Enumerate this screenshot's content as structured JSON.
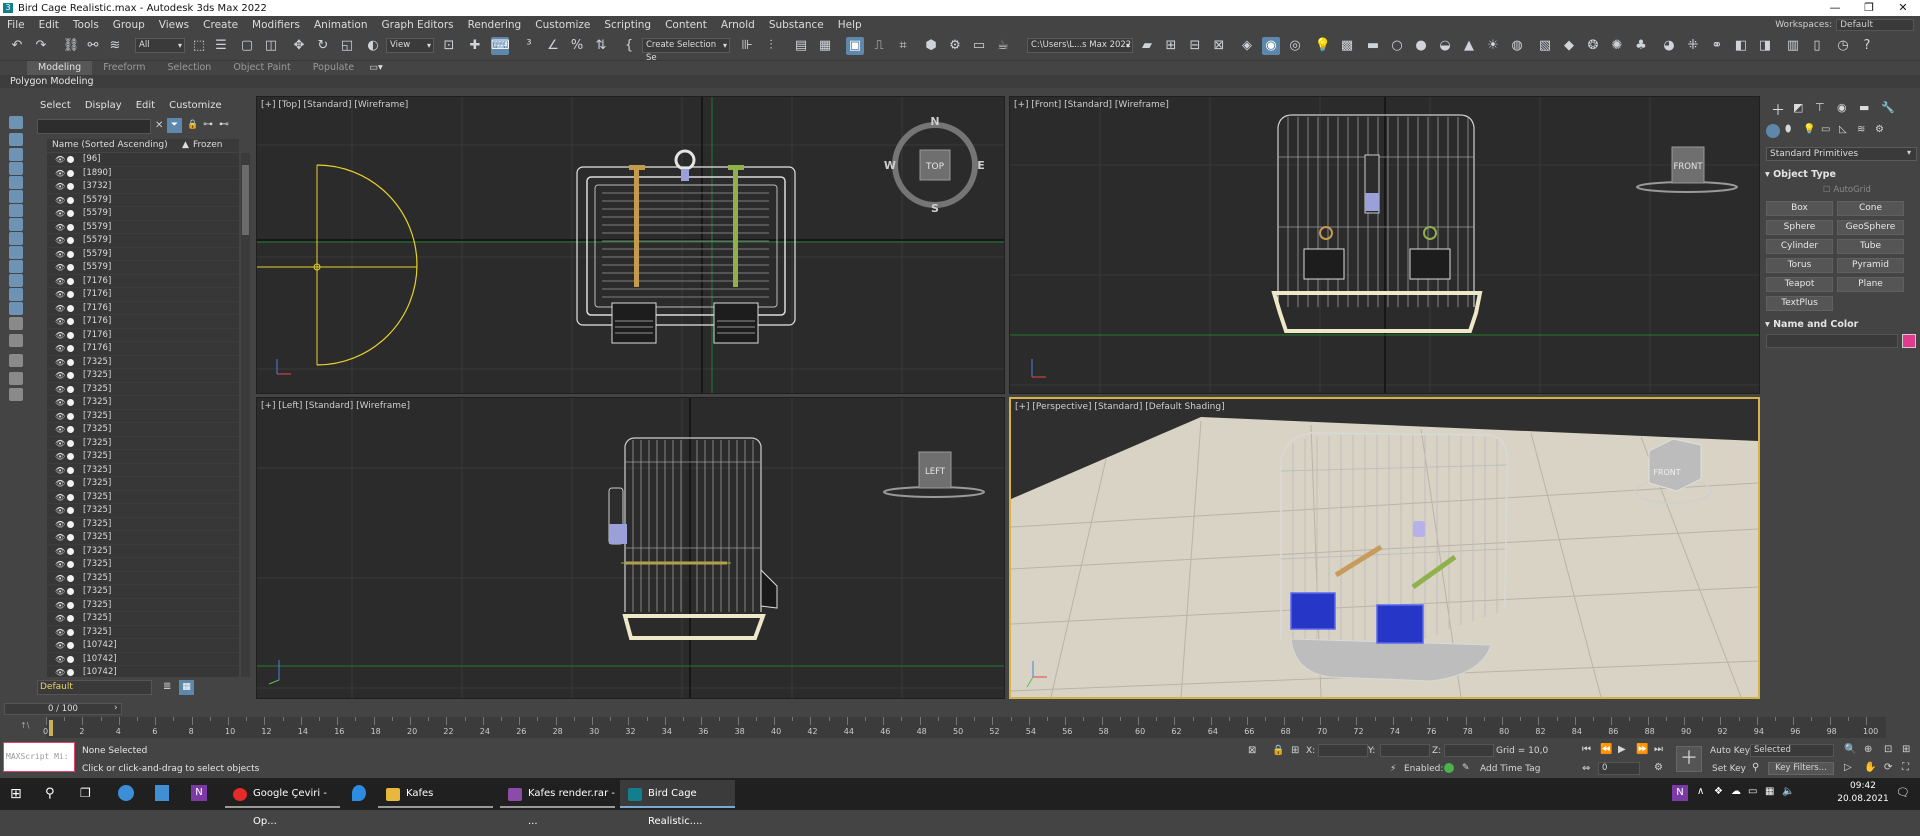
{
  "window": {
    "title": "Bird Cage Realistic.max - Autodesk 3ds Max 2022"
  },
  "menu": [
    "File",
    "Edit",
    "Tools",
    "Group",
    "Views",
    "Create",
    "Modifiers",
    "Animation",
    "Graph Editors",
    "Rendering",
    "Customize",
    "Scripting",
    "Content",
    "Arnold",
    "Substance",
    "Help"
  ],
  "workspace": {
    "label": "Workspaces:",
    "value": "Default"
  },
  "toolbar": {
    "filter": "All",
    "refcoord": "View",
    "named_selection": "Create Selection Se",
    "project_path": "C:\\Users\\L...s Max 2022"
  },
  "ribbon": {
    "tabs": [
      "Modeling",
      "Freeform",
      "Selection",
      "Object Paint",
      "Populate"
    ],
    "active_tab": "Modeling",
    "panel": "Polygon Modeling"
  },
  "scene_explorer": {
    "menu": [
      "Select",
      "Display",
      "Edit",
      "Customize"
    ],
    "col_name": "Name (Sorted Ascending)",
    "col_frozen": "Frozen",
    "rows": [
      "[96]",
      "[1890]",
      "[3732]",
      "[5579]",
      "[5579]",
      "[5579]",
      "[5579]",
      "[5579]",
      "[5579]",
      "[7176]",
      "[7176]",
      "[7176]",
      "[7176]",
      "[7176]",
      "[7176]",
      "[7325]",
      "[7325]",
      "[7325]",
      "[7325]",
      "[7325]",
      "[7325]",
      "[7325]",
      "[7325]",
      "[7325]",
      "[7325]",
      "[7325]",
      "[7325]",
      "[7325]",
      "[7325]",
      "[7325]",
      "[7325]",
      "[7325]",
      "[7325]",
      "[7325]",
      "[7325]",
      "[7325]",
      "[10742]",
      "[10742]",
      "[10742]",
      "[10742]"
    ],
    "layer": "Default"
  },
  "viewports": {
    "top": {
      "label": "[+] [Top] [Standard] [Wireframe]",
      "cube": "TOP",
      "compass": [
        "N",
        "E",
        "S",
        "W"
      ]
    },
    "front": {
      "label": "[+] [Front] [Standard] [Wireframe]",
      "cube": "FRONT"
    },
    "left": {
      "label": "[+] [Left] [Standard] [Wireframe]",
      "cube": "LEFT"
    },
    "persp": {
      "label": "[+] [Perspective] [Standard] [Default Shading]",
      "cube": "FRONT"
    }
  },
  "command_panel": {
    "category": "Standard Primitives",
    "object_type": "Object Type",
    "autogrid": "AutoGrid",
    "buttons": [
      "Box",
      "Cone",
      "Sphere",
      "GeoSphere",
      "Cylinder",
      "Tube",
      "Torus",
      "Pyramid",
      "Teapot",
      "Plane",
      "TextPlus"
    ],
    "name_and_color": "Name and Color",
    "color": "#e23a8c"
  },
  "timeline": {
    "frame": "0 / 100",
    "ticks": [
      "0",
      "2",
      "4",
      "6",
      "8",
      "10",
      "12",
      "14",
      "16",
      "18",
      "20",
      "22",
      "24",
      "26",
      "28",
      "30",
      "32",
      "34",
      "36",
      "38",
      "40",
      "42",
      "44",
      "46",
      "48",
      "50",
      "52",
      "54",
      "56",
      "58",
      "60",
      "62",
      "64",
      "66",
      "68",
      "70",
      "72",
      "74",
      "76",
      "78",
      "80",
      "82",
      "84",
      "86",
      "88",
      "90",
      "92",
      "94",
      "96",
      "98",
      "100"
    ]
  },
  "status": {
    "maxscript": "MAXScript Mi:",
    "selection": "None Selected",
    "prompt": "Click or click-and-drag to select objects",
    "x_label": "X:",
    "y_label": "Y:",
    "z_label": "Z:",
    "grid": "Grid = 10,0",
    "enabled": "Enabled:",
    "add_time_tag": "Add Time Tag",
    "auto_key": "Auto Key",
    "set_key": "Set Key",
    "selected": "Selected",
    "key_filters": "Key Filters...",
    "frame_value": "0"
  },
  "taskbar": {
    "items": [
      "Google Çeviri - Op...",
      "Kafes",
      "Kafes render.rar - ...",
      "Bird Cage Realistic...."
    ],
    "time": "09:42",
    "date": "20.08.2021"
  }
}
